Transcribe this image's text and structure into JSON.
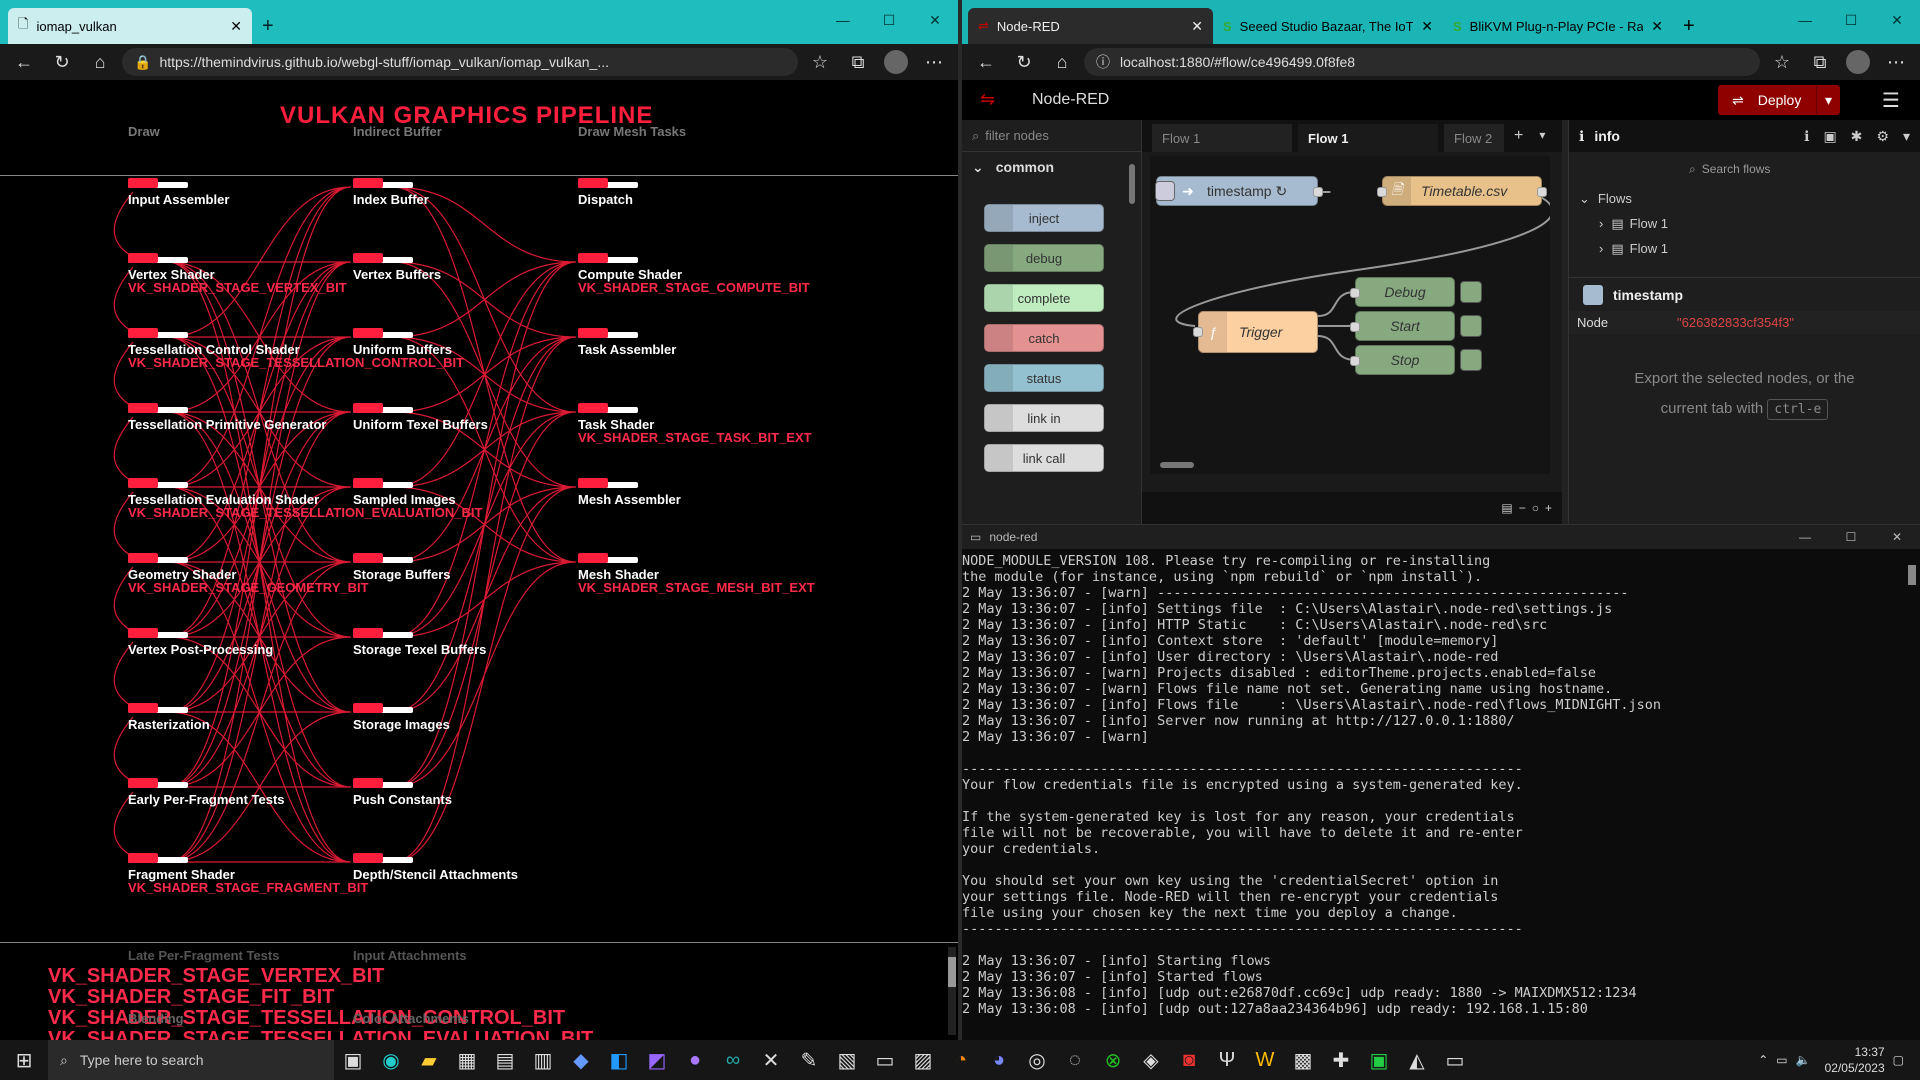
{
  "left_browser": {
    "tab_title": "iomap_vulkan",
    "url": "https://themindvirus.github.io/webgl-stuff/iomap_vulkan/iomap_vulkan_...",
    "page": {
      "title": "VULKAN GRAPHICS PIPELINE",
      "header_cols": [
        "Draw",
        "Indirect Buffer",
        "Draw Mesh Tasks"
      ],
      "col1": [
        {
          "label": "Input Assembler",
          "sub": ""
        },
        {
          "label": "Vertex Shader",
          "sub": "VK_SHADER_STAGE_VERTEX_BIT"
        },
        {
          "label": "Tessellation Control Shader",
          "sub": "VK_SHADER_STAGE_TESSELLATION_CONTROL_BIT"
        },
        {
          "label": "Tessellation Primitive Generator",
          "sub": ""
        },
        {
          "label": "Tessellation Evaluation Shader",
          "sub": "VK_SHADER_STAGE_TESSELLATION_EVALUATION_BIT"
        },
        {
          "label": "Geometry Shader",
          "sub": "VK_SHADER_STAGE_GEOMETRY_BIT"
        },
        {
          "label": "Vertex Post-Processing",
          "sub": ""
        },
        {
          "label": "Rasterization",
          "sub": ""
        },
        {
          "label": "Early Per-Fragment Tests",
          "sub": ""
        },
        {
          "label": "Fragment Shader",
          "sub": "VK_SHADER_STAGE_FRAGMENT_BIT"
        }
      ],
      "col2": [
        "Index Buffer",
        "Vertex Buffers",
        "Uniform Buffers",
        "Uniform Texel Buffers",
        "Sampled Images",
        "Storage Buffers",
        "Storage Texel Buffers",
        "Storage Images",
        "Push Constants",
        "Depth/Stencil Attachments"
      ],
      "col3": [
        {
          "label": "Dispatch",
          "sub": ""
        },
        {
          "label": "Compute Shader",
          "sub": "VK_SHADER_STAGE_COMPUTE_BIT"
        },
        {
          "label": "Task Assembler",
          "sub": ""
        },
        {
          "label": "Task Shader",
          "sub": "VK_SHADER_STAGE_TASK_BIT_EXT"
        },
        {
          "label": "Mesh Assembler",
          "sub": ""
        },
        {
          "label": "Mesh Shader",
          "sub": "VK_SHADER_STAGE_MESH_BIT_EXT"
        }
      ],
      "footer_faded": [
        "Late Per-Fragment Tests",
        "Input Attachments",
        "Blending",
        "Color Attachments"
      ],
      "footer_bits": [
        "VK_SHADER_STAGE_VERTEX_BIT",
        "VK_SHADER_STAGE_FIT_BIT",
        "VK_SHADER_STAGE_TESSELLATION_CONTROL_BIT",
        "VK_SHADER_STAGE_TESSELLATION_EVALUATION_BIT"
      ]
    }
  },
  "right_browser": {
    "tabs": [
      "Node-RED",
      "Seeed Studio Bazaar, The IoT Ha",
      "BliKVM Plug-n-Play PCIe - Raspb"
    ],
    "url": "localhost:1880/#flow/ce496499.0f8fe8",
    "nodered": {
      "brand": "Node-RED",
      "deploy": "Deploy",
      "filter_placeholder": "filter nodes",
      "category": "common",
      "palette": [
        {
          "label": "inject",
          "color": "#a6bbcf"
        },
        {
          "label": "debug",
          "color": "#87a980"
        },
        {
          "label": "complete",
          "color": "#c0edc0"
        },
        {
          "label": "catch",
          "color": "#e49191"
        },
        {
          "label": "status",
          "color": "#94c1d0"
        },
        {
          "label": "link in",
          "color": "#dddddd"
        },
        {
          "label": "link call",
          "color": "#dddddd"
        }
      ],
      "flow_tabs": [
        "Flow 1",
        "Flow 1",
        "Flow 2"
      ],
      "nodes": {
        "timestamp": "timestamp ↻",
        "timetable": "Timetable.csv",
        "trigger": "Trigger",
        "debug": "Debug",
        "start": "Start",
        "stop": "Stop"
      },
      "sidebar": {
        "title": "info",
        "search_placeholder": "Search flows",
        "tree_root": "Flows",
        "tree_items": [
          "Flow 1",
          "Flow 1"
        ],
        "node_title": "timestamp",
        "prop_key": "Node",
        "prop_val": "\"626382833cf354f3\"",
        "help_1": "Export the selected nodes, or the",
        "help_2": "current tab with",
        "help_key": "ctrl-e"
      }
    }
  },
  "terminal": {
    "title": "node-red",
    "lines": [
      "NODE_MODULE_VERSION 108. Please try re-compiling or re-installing",
      "the module (for instance, using `npm rebuild` or `npm install`).",
      "2 May 13:36:07 - [warn] ----------------------------------------------------------",
      "2 May 13:36:07 - [info] Settings file  : C:\\Users\\Alastair\\.node-red\\settings.js",
      "2 May 13:36:07 - [info] HTTP Static    : C:\\Users\\Alastair\\.node-red\\src",
      "2 May 13:36:07 - [info] Context store  : 'default' [module=memory]",
      "2 May 13:36:07 - [info] User directory : \\Users\\Alastair\\.node-red",
      "2 May 13:36:07 - [warn] Projects disabled : editorTheme.projects.enabled=false",
      "2 May 13:36:07 - [warn] Flows file name not set. Generating name using hostname.",
      "2 May 13:36:07 - [info] Flows file     : \\Users\\Alastair\\.node-red\\flows_MIDNIGHT.json",
      "2 May 13:36:07 - [info] Server now running at http://127.0.0.1:1880/",
      "2 May 13:36:07 - [warn]",
      "",
      "---------------------------------------------------------------------",
      "Your flow credentials file is encrypted using a system-generated key.",
      "",
      "If the system-generated key is lost for any reason, your credentials",
      "file will not be recoverable, you will have to delete it and re-enter",
      "your credentials.",
      "",
      "You should set your own key using the 'credentialSecret' option in",
      "your settings file. Node-RED will then re-encrypt your credentials",
      "file using your chosen key the next time you deploy a change.",
      "---------------------------------------------------------------------",
      "",
      "2 May 13:36:07 - [info] Starting flows",
      "2 May 13:36:07 - [info] Started flows",
      "2 May 13:36:08 - [info] [udp out:e26870df.cc69c] udp ready: 1880 -> MAIXDMX512:1234",
      "2 May 13:36:08 - [info] [udp out:127a8aa234364b96] udp ready: 192.168.1.15:80"
    ]
  },
  "taskbar": {
    "search_placeholder": "Type here to search",
    "time": "13:37",
    "date": "02/05/2023"
  },
  "colors": {
    "accent_left": "#1fbdbd",
    "accent_right": "#1cb5b5",
    "vk_red": "#ff1e3c",
    "nr_header": "#8f0000"
  }
}
